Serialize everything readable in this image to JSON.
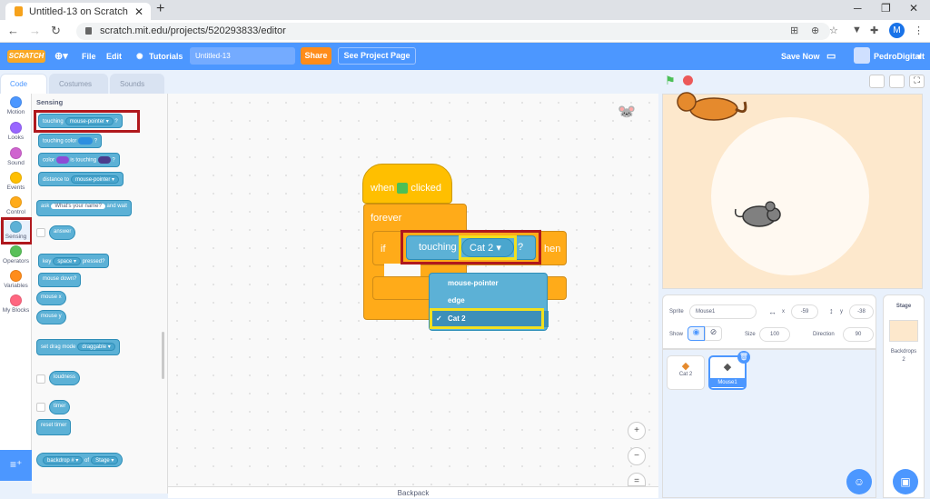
{
  "browser": {
    "tab_title": "Untitled-13 on Scratch",
    "tab_close": "✕",
    "new_tab": "+",
    "url": "scratch.mit.edu/projects/520293833/editor",
    "profile_initial": "M"
  },
  "menubar": {
    "logo": "SCRATCH",
    "file": "File",
    "edit": "Edit",
    "tutorials": "Tutorials",
    "project_title": "Untitled-13",
    "share": "Share",
    "see_project_page": "See Project Page",
    "save_now": "Save Now",
    "username": "PedroDigitalt"
  },
  "editor_tabs": {
    "code": "Code",
    "costumes": "Costumes",
    "sounds": "Sounds"
  },
  "categories": [
    {
      "label": "Motion",
      "color": "#4c97ff"
    },
    {
      "label": "Looks",
      "color": "#9966ff"
    },
    {
      "label": "Sound",
      "color": "#cf63cf"
    },
    {
      "label": "Events",
      "color": "#ffbf00"
    },
    {
      "label": "Control",
      "color": "#ffab19"
    },
    {
      "label": "Sensing",
      "color": "#5cb1d6"
    },
    {
      "label": "Operators",
      "color": "#59c059"
    },
    {
      "label": "Variables",
      "color": "#ff8c1a"
    },
    {
      "label": "My Blocks",
      "color": "#ff6680"
    }
  ],
  "palette": {
    "title": "Sensing",
    "touching": "touching",
    "mouse_pointer": "mouse-pointer ▾",
    "q": "?",
    "touching_color": "touching color",
    "color": "color",
    "is_touching": "is touching",
    "distance_to": "distance to",
    "ask": "ask",
    "ask_default": "What's your name?",
    "and_wait": "and wait",
    "answer": "answer",
    "key": "key",
    "space": "space ▾",
    "pressed": "pressed?",
    "mouse_down": "mouse down?",
    "mouse_x": "mouse x",
    "mouse_y": "mouse y",
    "set_drag_mode": "set drag mode",
    "draggable": "draggable ▾",
    "loudness": "loudness",
    "timer": "timer",
    "reset_timer": "reset timer",
    "backdrop": "backdrop # ▾",
    "of": "of",
    "stage": "Stage ▾"
  },
  "script": {
    "when": "when",
    "clicked": "clicked",
    "forever": "forever",
    "if": "if",
    "then": "hen",
    "touching": "touching",
    "target": "Cat 2",
    "q": "?"
  },
  "dropdown": {
    "options": [
      "mouse-pointer",
      "edge",
      "Cat 2"
    ],
    "selected": "Cat 2",
    "check": "✓"
  },
  "zoom": {
    "in": "+",
    "out": "−",
    "reset": "="
  },
  "backpack": "Backpack",
  "sprite_info": {
    "sprite_label": "Sprite",
    "sprite_name": "Mouse1",
    "x_label": "x",
    "x": "-59",
    "y_label": "y",
    "y": "-38",
    "show_label": "Show",
    "size_label": "Size",
    "size": "100",
    "direction_label": "Direction",
    "direction": "90"
  },
  "sprites": [
    {
      "name": "Cat 2",
      "selected": false
    },
    {
      "name": "Mouse1",
      "selected": true
    }
  ],
  "stage_panel": {
    "title": "Stage",
    "backdrops_label": "Backdrops",
    "backdrops_count": "2"
  }
}
